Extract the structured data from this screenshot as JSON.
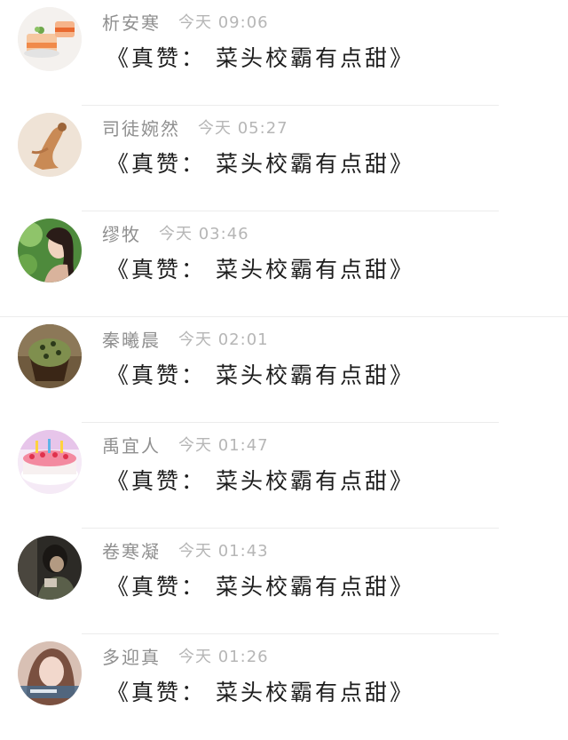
{
  "rows": [
    {
      "name": "析安寒",
      "time": "今天 09:06",
      "message": "《真赞： 菜头校霸有点甜》",
      "avatar": "avatar-cake-slice"
    },
    {
      "name": "司徒婉然",
      "time": "今天 05:27",
      "message": "《真赞： 菜头校霸有点甜》",
      "avatar": "avatar-figure"
    },
    {
      "name": "缪牧",
      "time": "今天 03:46",
      "message": "《真赞： 菜头校霸有点甜》",
      "avatar": "avatar-portrait"
    },
    {
      "name": "秦曦晨",
      "time": "今天 02:01",
      "message": "《真赞： 菜头校霸有点甜》",
      "avatar": "avatar-cupcake"
    },
    {
      "name": "禹宜人",
      "time": "今天 01:47",
      "message": "《真赞： 菜头校霸有点甜》",
      "avatar": "avatar-birthday-cake"
    },
    {
      "name": "卷寒凝",
      "time": "今天 01:43",
      "message": "《真赞： 菜头校霸有点甜》",
      "avatar": "avatar-dark-photo"
    },
    {
      "name": "多迎真",
      "time": "今天 01:26",
      "message": "《真赞： 菜头校霸有点甜》",
      "avatar": "avatar-girl"
    }
  ]
}
